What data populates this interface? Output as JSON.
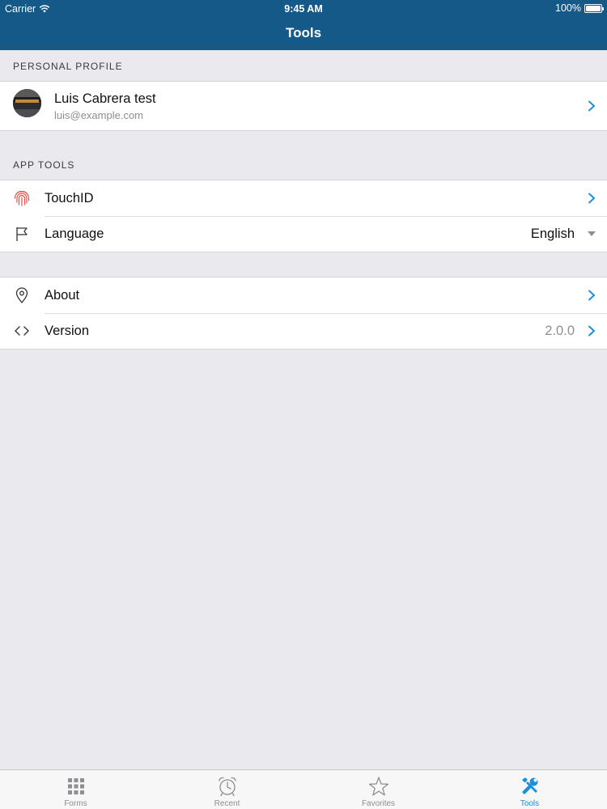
{
  "status_bar": {
    "carrier": "Carrier",
    "time": "9:45 AM",
    "battery": "100%",
    "battery_level": 1.0
  },
  "nav": {
    "title": "Tools"
  },
  "personal_profile": {
    "header": "PERSONAL PROFILE",
    "name": "Luis Cabrera test",
    "email": "luis@example.com"
  },
  "app_tools": {
    "header": "APP TOOLS",
    "touchid_label": "TouchID",
    "language_label": "Language",
    "language_value": "English"
  },
  "info": {
    "about_label": "About",
    "version_label": "Version",
    "version_value": "2.0.0"
  },
  "tabbar": {
    "tabs": [
      {
        "label": "Forms",
        "icon": "grid-icon"
      },
      {
        "label": "Recent",
        "icon": "alarm-clock-icon"
      },
      {
        "label": "Favorites",
        "icon": "star-icon"
      },
      {
        "label": "Tools",
        "icon": "tools-icon"
      }
    ],
    "active_index": 3
  },
  "colors": {
    "nav_bar": "#155988",
    "accent": "#1a8fdc",
    "background": "#e9e9ee",
    "touchid_icon": "#e0524a"
  }
}
